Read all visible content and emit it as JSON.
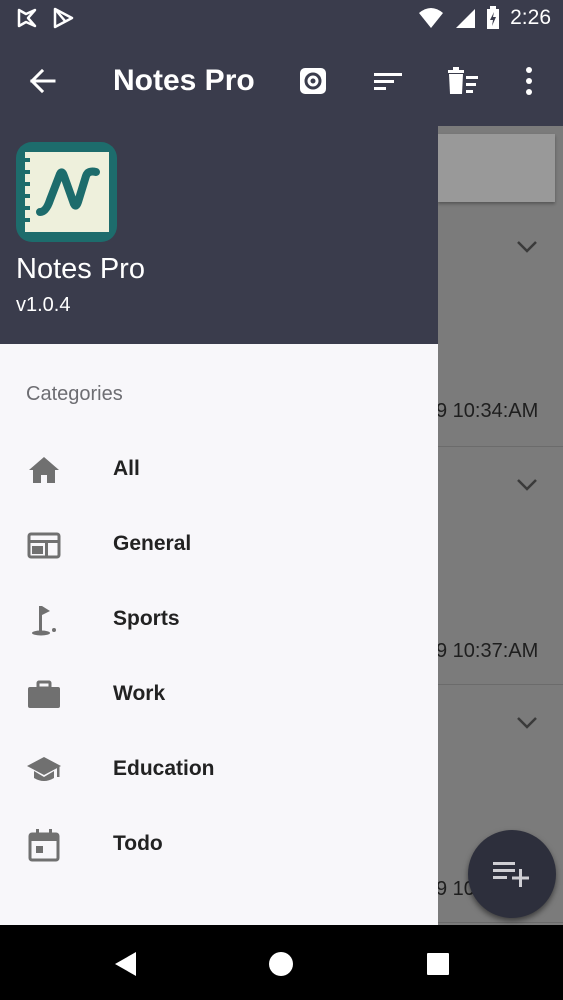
{
  "status_bar": {
    "time": "2:26",
    "icons": [
      "play-protect-icon",
      "play-store-icon",
      "wifi-icon",
      "signal-icon",
      "battery-charging-icon"
    ]
  },
  "app_bar": {
    "title": "Notes Pro",
    "actions": [
      "back-arrow-icon",
      "settings-icon",
      "sort-icon",
      "delete-sort-icon",
      "more-vert-icon"
    ]
  },
  "drawer": {
    "app_name": "Notes Pro",
    "version": "v1.0.4",
    "section_title": "Categories",
    "items": [
      {
        "label": "All",
        "icon": "home-icon"
      },
      {
        "label": "General",
        "icon": "web-icon"
      },
      {
        "label": "Sports",
        "icon": "golf-icon"
      },
      {
        "label": "Work",
        "icon": "briefcase-icon"
      },
      {
        "label": "Education",
        "icon": "school-icon"
      },
      {
        "label": "Todo",
        "icon": "calendar-icon"
      }
    ]
  },
  "background_notes": [
    {
      "date": "9 10:34:AM"
    },
    {
      "date": "9 10:37:AM"
    },
    {
      "date": "9 10"
    }
  ],
  "colors": {
    "primary": "#3a3c4c",
    "drawer_bg": "#f8f7fa",
    "logo_teal": "#1d6c6c",
    "logo_paper": "#eef0dc"
  }
}
